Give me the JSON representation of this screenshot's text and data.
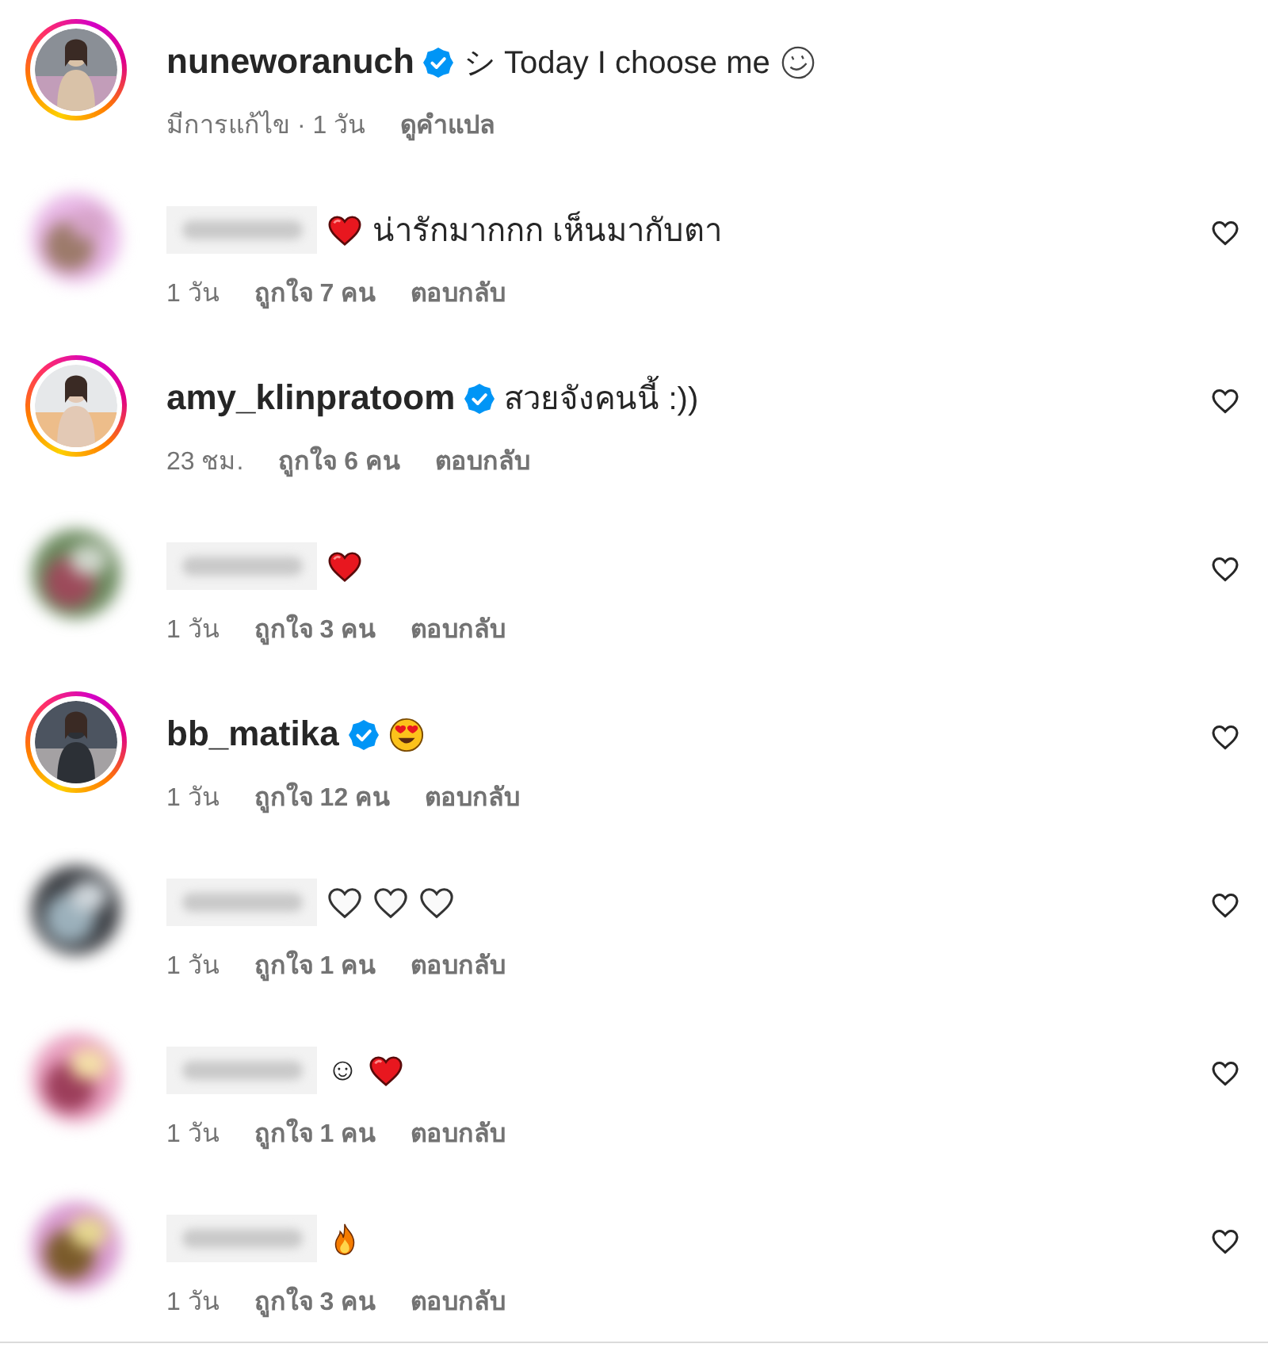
{
  "caption": {
    "username": "nuneworanuch",
    "verified": true,
    "avatar": {
      "kind": "picture",
      "story_ring": true
    },
    "content": [
      {
        "kind": "text",
        "text": "シ Today I choose me"
      },
      {
        "kind": "smiley_outline"
      }
    ],
    "meta": [
      {
        "kind": "text",
        "text": "มีการแก้ไข · 1 วัน"
      },
      {
        "kind": "link",
        "text": "ดูคำแปล"
      }
    ]
  },
  "comments": [
    {
      "username_hidden": true,
      "verified": false,
      "avatar": {
        "kind": "picture",
        "story_ring": false
      },
      "content": [
        {
          "kind": "red_heart"
        },
        {
          "kind": "text",
          "text": "น่ารักมากกก เห็นมากับตา"
        }
      ],
      "time": "1 วัน",
      "likes": "ถูกใจ 7 คน",
      "reply": "ตอบกลับ",
      "liked": false
    },
    {
      "username_hidden": false,
      "username": "amy_klinpratoom",
      "verified": true,
      "avatar": {
        "kind": "picture",
        "story_ring": true
      },
      "content": [
        {
          "kind": "text",
          "text": "สวยจังคนนี้ :))"
        }
      ],
      "time": "23 ชม.",
      "likes": "ถูกใจ 6 คน",
      "reply": "ตอบกลับ",
      "liked": false
    },
    {
      "username_hidden": true,
      "verified": false,
      "avatar": {
        "kind": "picture",
        "story_ring": false
      },
      "content": [
        {
          "kind": "red_heart"
        }
      ],
      "time": "1 วัน",
      "likes": "ถูกใจ 3 คน",
      "reply": "ตอบกลับ",
      "liked": false
    },
    {
      "username_hidden": false,
      "username": "bb_matika",
      "verified": true,
      "avatar": {
        "kind": "picture",
        "story_ring": true
      },
      "content": [
        {
          "kind": "heart_eyes"
        }
      ],
      "time": "1 วัน",
      "likes": "ถูกใจ 12 คน",
      "reply": "ตอบกลับ",
      "liked": false
    },
    {
      "username_hidden": true,
      "verified": false,
      "avatar": {
        "kind": "picture",
        "story_ring": false
      },
      "content": [
        {
          "kind": "white_heart"
        },
        {
          "kind": "white_heart"
        },
        {
          "kind": "white_heart"
        }
      ],
      "time": "1 วัน",
      "likes": "ถูกใจ 1 คน",
      "reply": "ตอบกลับ",
      "liked": false
    },
    {
      "username_hidden": true,
      "verified": false,
      "avatar": {
        "kind": "picture",
        "story_ring": false
      },
      "content": [
        {
          "kind": "text",
          "text": "☺"
        },
        {
          "kind": "red_heart"
        }
      ],
      "time": "1 วัน",
      "likes": "ถูกใจ 1 คน",
      "reply": "ตอบกลับ",
      "liked": false
    },
    {
      "username_hidden": true,
      "verified": false,
      "avatar": {
        "kind": "picture",
        "story_ring": false
      },
      "content": [
        {
          "kind": "fire"
        }
      ],
      "time": "1 วัน",
      "likes": "ถูกใจ 3 คน",
      "reply": "ตอบกลับ",
      "liked": false
    }
  ]
}
